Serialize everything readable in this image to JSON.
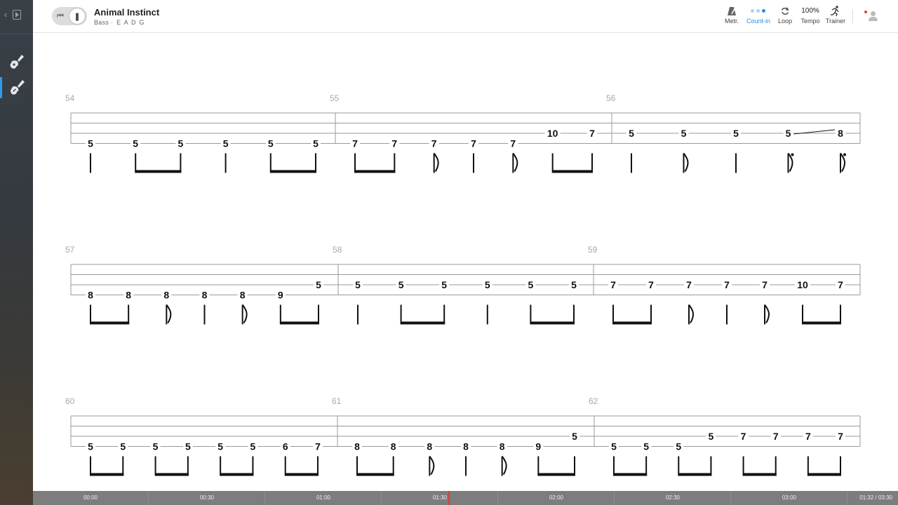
{
  "sidebar": {
    "instruments": [
      {
        "name": "guitar-icon",
        "active": false
      },
      {
        "name": "bass-icon",
        "active": true
      }
    ]
  },
  "header": {
    "title": "Animal Instinct",
    "instrument": "Bass",
    "separator": "·",
    "tuning": "E A D G",
    "tools": {
      "metronome": "Metr.",
      "count_in": "Count-in",
      "loop": "Loop",
      "tempo_value": "100%",
      "tempo": "Tempo",
      "trainer": "Trainer"
    }
  },
  "score": {
    "systems": [
      {
        "measures": [
          {
            "number": "54",
            "notes": [
              {
                "fret": "5",
                "string": 4,
                "dur": "q"
              },
              {
                "fret": "5",
                "string": 4,
                "dur": "8",
                "beam": "s"
              },
              {
                "fret": "5",
                "string": 4,
                "dur": "8",
                "beam": "e"
              },
              {
                "fret": "5",
                "string": 4,
                "dur": "q"
              },
              {
                "fret": "5",
                "string": 4,
                "dur": "8",
                "beam": "s"
              },
              {
                "fret": "5",
                "string": 4,
                "dur": "8",
                "beam": "e"
              }
            ]
          },
          {
            "number": "55",
            "notes": [
              {
                "fret": "7",
                "string": 4,
                "dur": "8",
                "beam": "s"
              },
              {
                "fret": "7",
                "string": 4,
                "dur": "8",
                "beam": "e"
              },
              {
                "fret": "7",
                "string": 4,
                "dur": "8f"
              },
              {
                "fret": "7",
                "string": 4,
                "dur": "q"
              },
              {
                "fret": "7",
                "string": 4,
                "dur": "8f"
              },
              {
                "fret": "10",
                "string": 3,
                "dur": "8",
                "beam": "s"
              },
              {
                "fret": "7",
                "string": 3,
                "dur": "8",
                "beam": "e"
              }
            ]
          },
          {
            "number": "56",
            "notes": [
              {
                "fret": "5",
                "string": 3,
                "dur": "q"
              },
              {
                "fret": "5",
                "string": 3,
                "dur": "8f"
              },
              {
                "fret": "5",
                "string": 3,
                "dur": "q"
              },
              {
                "fret": "5",
                "string": 3,
                "dur": "8fd",
                "slide": true
              },
              {
                "fret": "8",
                "string": 3,
                "dur": "8fd"
              }
            ]
          }
        ]
      },
      {
        "measures": [
          {
            "number": "57",
            "notes": [
              {
                "fret": "8",
                "string": 4,
                "dur": "8",
                "beam": "s"
              },
              {
                "fret": "8",
                "string": 4,
                "dur": "8",
                "beam": "e"
              },
              {
                "fret": "8",
                "string": 4,
                "dur": "8f"
              },
              {
                "fret": "8",
                "string": 4,
                "dur": "q"
              },
              {
                "fret": "8",
                "string": 4,
                "dur": "8f"
              },
              {
                "fret": "9",
                "string": 4,
                "dur": "8",
                "beam": "s"
              },
              {
                "fret": "5",
                "string": 3,
                "dur": "8",
                "beam": "e"
              }
            ]
          },
          {
            "number": "58",
            "notes": [
              {
                "fret": "5",
                "string": 3,
                "dur": "q"
              },
              {
                "fret": "5",
                "string": 3,
                "dur": "8",
                "beam": "s"
              },
              {
                "fret": "5",
                "string": 3,
                "dur": "8",
                "beam": "e"
              },
              {
                "fret": "5",
                "string": 3,
                "dur": "q"
              },
              {
                "fret": "5",
                "string": 3,
                "dur": "8",
                "beam": "s"
              },
              {
                "fret": "5",
                "string": 3,
                "dur": "8",
                "beam": "e"
              }
            ]
          },
          {
            "number": "59",
            "notes": [
              {
                "fret": "7",
                "string": 3,
                "dur": "8",
                "beam": "s"
              },
              {
                "fret": "7",
                "string": 3,
                "dur": "8",
                "beam": "e"
              },
              {
                "fret": "7",
                "string": 3,
                "dur": "8f"
              },
              {
                "fret": "7",
                "string": 3,
                "dur": "q"
              },
              {
                "fret": "7",
                "string": 3,
                "dur": "8f"
              },
              {
                "fret": "10",
                "string": 3,
                "dur": "8",
                "beam": "s"
              },
              {
                "fret": "7",
                "string": 3,
                "dur": "8",
                "beam": "e"
              }
            ]
          }
        ]
      },
      {
        "measures": [
          {
            "number": "60",
            "notes": [
              {
                "fret": "5",
                "string": 4,
                "dur": "8",
                "beam": "s"
              },
              {
                "fret": "5",
                "string": 4,
                "dur": "8",
                "beam": "e"
              },
              {
                "fret": "5",
                "string": 4,
                "dur": "8",
                "beam": "s"
              },
              {
                "fret": "5",
                "string": 4,
                "dur": "8",
                "beam": "e"
              },
              {
                "fret": "5",
                "string": 4,
                "dur": "8",
                "beam": "s"
              },
              {
                "fret": "5",
                "string": 4,
                "dur": "8",
                "beam": "e"
              },
              {
                "fret": "6",
                "string": 4,
                "dur": "8",
                "beam": "s"
              },
              {
                "fret": "7",
                "string": 4,
                "dur": "8",
                "beam": "e"
              }
            ]
          },
          {
            "number": "61",
            "notes": [
              {
                "fret": "8",
                "string": 4,
                "dur": "8",
                "beam": "s"
              },
              {
                "fret": "8",
                "string": 4,
                "dur": "8",
                "beam": "e"
              },
              {
                "fret": "8",
                "string": 4,
                "dur": "8f"
              },
              {
                "fret": "8",
                "string": 4,
                "dur": "q"
              },
              {
                "fret": "8",
                "string": 4,
                "dur": "8f"
              },
              {
                "fret": "9",
                "string": 4,
                "dur": "8",
                "beam": "s"
              },
              {
                "fret": "5",
                "string": 3,
                "dur": "8",
                "beam": "e"
              }
            ]
          },
          {
            "number": "62",
            "notes": [
              {
                "fret": "5",
                "string": 4,
                "dur": "8",
                "beam": "s"
              },
              {
                "fret": "5",
                "string": 4,
                "dur": "8",
                "beam": "e"
              },
              {
                "fret": "5",
                "string": 4,
                "dur": "8",
                "beam": "s"
              },
              {
                "fret": "5",
                "string": 3,
                "dur": "8",
                "beam": "e"
              },
              {
                "fret": "7",
                "string": 3,
                "dur": "8",
                "beam": "s"
              },
              {
                "fret": "7",
                "string": 3,
                "dur": "8",
                "beam": "e"
              },
              {
                "fret": "7",
                "string": 3,
                "dur": "8",
                "beam": "s"
              },
              {
                "fret": "7",
                "string": 3,
                "dur": "8",
                "beam": "e"
              }
            ]
          }
        ]
      }
    ]
  },
  "timeline": {
    "ticks": [
      "00:00",
      "00:30",
      "01:00",
      "01:30",
      "02:00",
      "02:30",
      "03:00"
    ],
    "readout": "01:32 / 03:30",
    "position_seconds": 92,
    "duration_seconds": 210,
    "playhead_color": "#e53935"
  }
}
